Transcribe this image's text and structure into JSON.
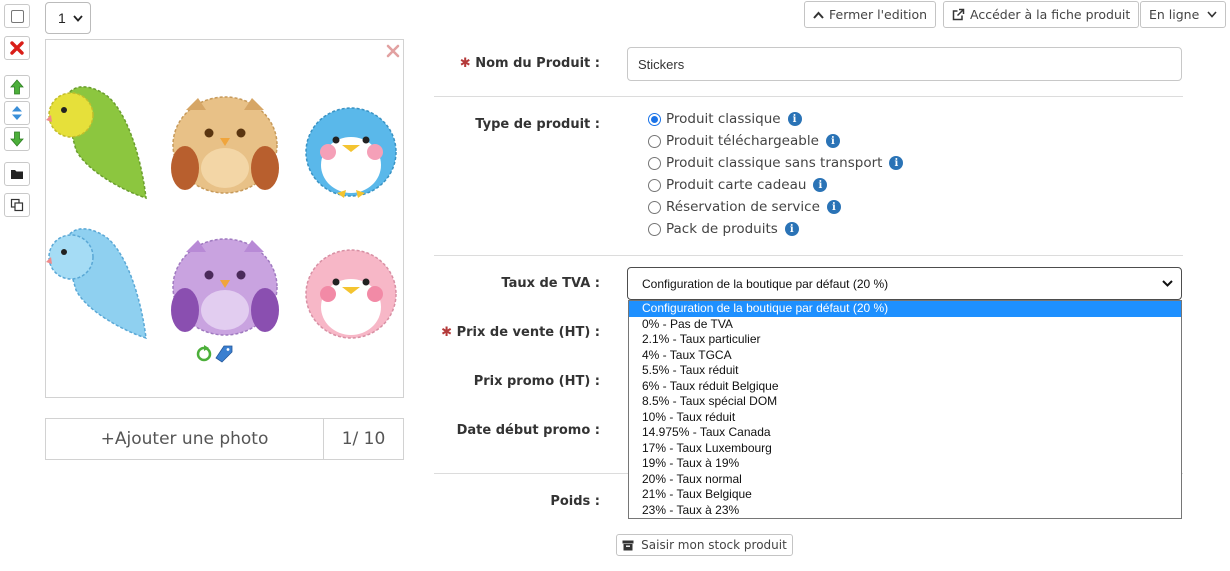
{
  "toolbar": {
    "quantity_value": "1",
    "icons": [
      "checkbox",
      "delete-icon",
      "arrow-up-icon",
      "arrow-updown-icon",
      "arrow-down-icon",
      "folder-icon",
      "copy-icon"
    ]
  },
  "gallery": {
    "add_photo_label": "+Ajouter une photo",
    "photo_count": "1/ 10"
  },
  "header_buttons": {
    "close_label": "Fermer l'edition",
    "open_label": "Accéder à la fiche produit",
    "status_label": "En ligne"
  },
  "form": {
    "name_label": "Nom du Produit :",
    "name_value": "Stickers",
    "type_label": "Type de produit :",
    "type_options": [
      "Produit classique",
      "Produit téléchargeable",
      "Produit classique sans transport",
      "Produit carte cadeau",
      "Réservation de service",
      "Pack de produits"
    ],
    "type_selected_index": 0,
    "tva_label": "Taux de TVA :",
    "tva_value": "Configuration de la boutique par défaut (20 %)",
    "tva_options": [
      "Configuration de la boutique par défaut (20 %)",
      "0% - Pas de TVA",
      "2.1% - Taux particulier",
      "4% - Taux TGCA",
      "5.5% - Taux réduit",
      "6% - Taux réduit Belgique",
      "8.5% - Taux spécial DOM",
      "10% - Taux réduit",
      "14.975% - Taux Canada",
      "17% - Taux Luxembourg",
      "19% - Taux à 19%",
      "20% - Taux normal",
      "21% - Taux Belgique",
      "23% - Taux à 23%"
    ],
    "price_label": "Prix de vente (HT) :",
    "promo_price_label": "Prix promo (HT) :",
    "promo_start_label": "Date début promo :",
    "weight_label": "Poids :",
    "stock_button_label": "Saisir mon stock produit"
  },
  "colors": {
    "accent": "#1a73e8",
    "selected_option": "#1e90ff",
    "required": "#b43a3a",
    "info": "#2a73b6"
  }
}
